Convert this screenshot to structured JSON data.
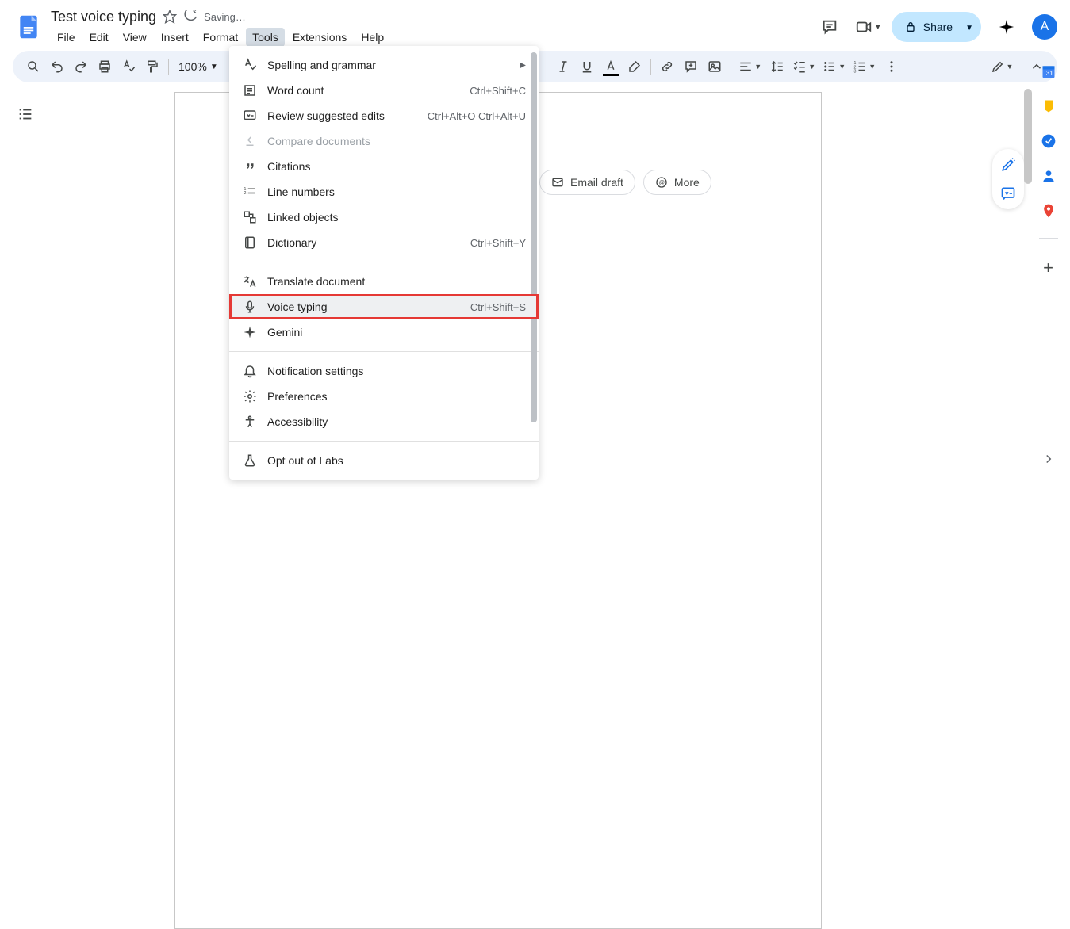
{
  "header": {
    "title": "Test voice typing",
    "saving": "Saving…",
    "avatar_initial": "A",
    "share_label": "Share"
  },
  "menubar": [
    "File",
    "Edit",
    "View",
    "Insert",
    "Format",
    "Tools",
    "Extensions",
    "Help"
  ],
  "toolbar": {
    "zoom": "100%"
  },
  "dropdown": {
    "items": [
      {
        "label": "Spelling and grammar",
        "shortcut": "",
        "submenu": true
      },
      {
        "label": "Word count",
        "shortcut": "Ctrl+Shift+C"
      },
      {
        "label": "Review suggested edits",
        "shortcut": "Ctrl+Alt+O Ctrl+Alt+U"
      },
      {
        "label": "Compare documents",
        "disabled": true
      },
      {
        "label": "Citations"
      },
      {
        "label": "Line numbers"
      },
      {
        "label": "Linked objects"
      },
      {
        "label": "Dictionary",
        "shortcut": "Ctrl+Shift+Y"
      },
      {
        "divider": true
      },
      {
        "label": "Translate document"
      },
      {
        "label": "Voice typing",
        "shortcut": "Ctrl+Shift+S",
        "highlighted": true
      },
      {
        "label": "Gemini"
      },
      {
        "divider": true
      },
      {
        "label": "Notification settings"
      },
      {
        "label": "Preferences"
      },
      {
        "label": "Accessibility"
      },
      {
        "divider": true
      },
      {
        "label": "Opt out of Labs"
      }
    ]
  },
  "chips": [
    {
      "label": "Email draft"
    },
    {
      "label": "More"
    }
  ]
}
